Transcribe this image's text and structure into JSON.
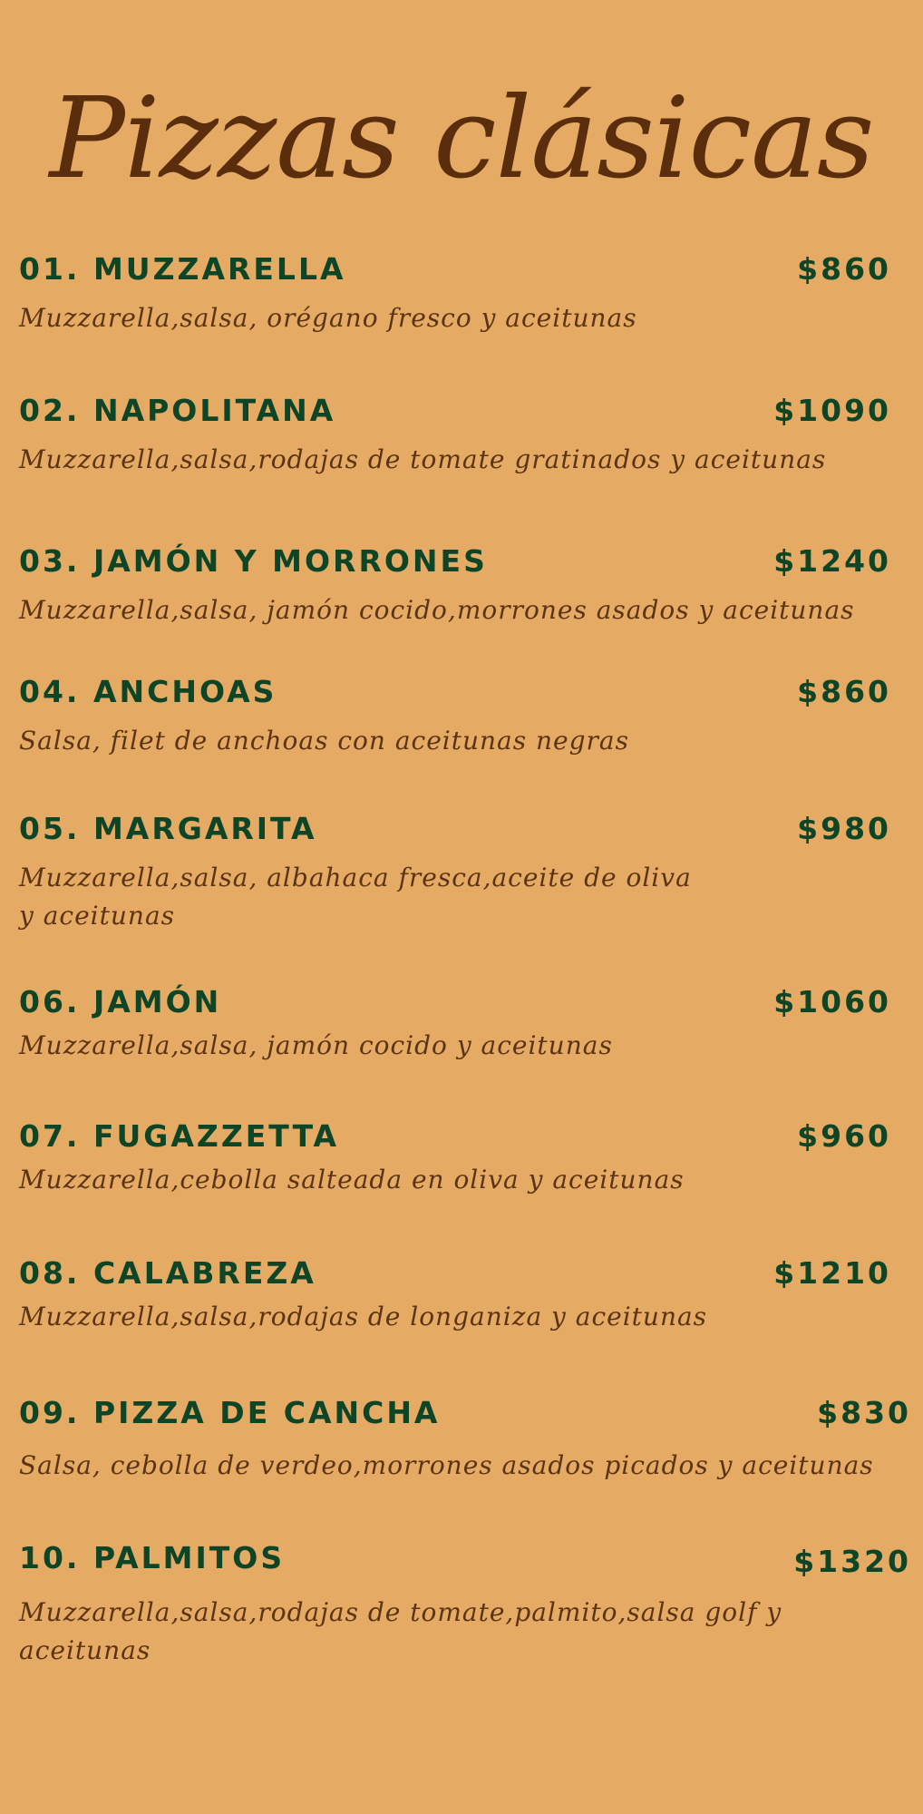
{
  "title": "Pizzas clásicas",
  "items": [
    {
      "name": "01. MUZZARELLA",
      "price": "$860",
      "description": "Muzzarella,salsa, orégano fresco y aceitunas"
    },
    {
      "name": "02. NAPOLITANA",
      "price": "$1090",
      "description": "Muzzarella,salsa,rodajas de tomate gratinados y aceitunas"
    },
    {
      "name": "03. JAMÓN Y MORRONES",
      "price": "$1240",
      "description": "Muzzarella,salsa, jamón cocido,morrones asados y aceitunas"
    },
    {
      "name": "04. ANCHOAS",
      "price": "$860",
      "description": "Salsa, filet de anchoas con aceitunas negras"
    },
    {
      "name": "05. MARGARITA",
      "price": "$980",
      "description_lines": [
        "Muzzarella,salsa, albahaca fresca,aceite de oliva",
        "y aceitunas"
      ]
    },
    {
      "name": "06. JAMÓN",
      "price": "$1060",
      "description": "Muzzarella,salsa, jamón cocido y aceitunas"
    },
    {
      "name": "07. FUGAZZETTA",
      "price": "$960",
      "description": "Muzzarella,cebolla salteada en oliva y aceitunas"
    },
    {
      "name": "08. CALABREZA",
      "price": "$1210",
      "description": "Muzzarella,salsa,rodajas de longaniza y aceitunas"
    },
    {
      "name": "09. PIZZA DE CANCHA",
      "price": "$830",
      "description": "Salsa, cebolla de verdeo,morrones asados picados y aceitunas"
    },
    {
      "name": "10. PALMITOS",
      "price": "$1320",
      "description_lines": [
        "Muzzarella,salsa,rodajas de tomate,palmito,salsa golf y",
        "aceitunas"
      ]
    }
  ]
}
